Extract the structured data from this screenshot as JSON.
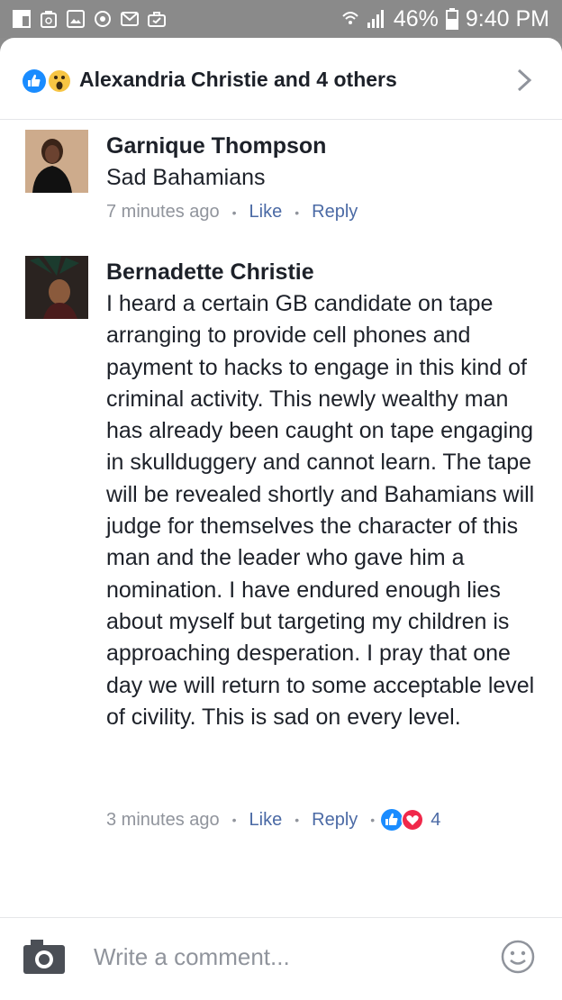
{
  "status_bar": {
    "battery": "46%",
    "time": "9:40 PM",
    "icons": [
      "flipboard-icon",
      "recycle-icon",
      "image-icon",
      "sync-icon",
      "mail-icon",
      "briefcase-icon",
      "wifi-icon",
      "signal-icon",
      "battery-icon"
    ]
  },
  "reactions": {
    "summary": "Alexandria Christie and 4 others",
    "icons": [
      "like-icon",
      "wow-icon"
    ]
  },
  "comments": [
    {
      "author": "Garnique Thompson",
      "text": "Sad Bahamians",
      "time": "7 minutes ago",
      "like_label": "Like",
      "reply_label": "Reply"
    },
    {
      "author": "Bernadette Christie",
      "text": "I heard a certain GB candidate on tape arranging to provide cell phones and payment to hacks to engage in this kind of criminal activity.  This newly wealthy man has already been caught on tape engaging in skullduggery and cannot learn.  The tape will be revealed shortly and Bahamians will judge for themselves the character of this man and the leader who gave him a nomination.  I have endured enough lies about myself but targeting my children is approaching desperation.  I pray that one day we will return to some acceptable level of civility.  This is sad on every level.",
      "time": "3 minutes ago",
      "like_label": "Like",
      "reply_label": "Reply",
      "reaction_count": "4",
      "reaction_icons": [
        "like-icon",
        "love-icon"
      ]
    }
  ],
  "composer": {
    "placeholder": "Write a comment..."
  },
  "colors": {
    "accent": "#4b6aa5",
    "like_blue": "#1a8cff",
    "love_red": "#f0284a",
    "wow_yellow": "#f7c544"
  }
}
